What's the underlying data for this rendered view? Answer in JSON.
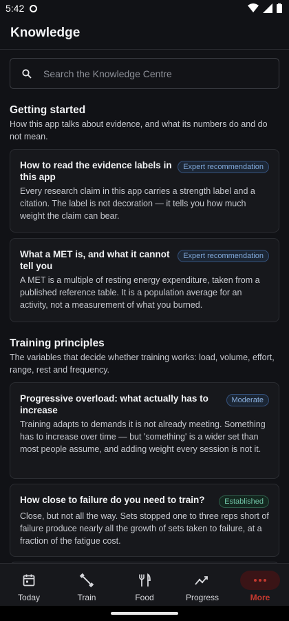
{
  "status": {
    "time": "5:42"
  },
  "app": {
    "title": "Knowledge"
  },
  "search": {
    "placeholder": "Search the Knowledge Centre"
  },
  "sections": [
    {
      "title": "Getting started",
      "description": "How this app talks about evidence, and what its numbers do and do not mean.",
      "cards": [
        {
          "title": "How to read the evidence labels in this app",
          "badge": "Expert recommendation",
          "body": "Every research claim in this app carries a strength label and a citation. The label is not decoration — it tells you how much weight the claim can bear."
        },
        {
          "title": "What a MET is, and what it cannot tell you",
          "badge": "Expert recommendation",
          "body": "A MET is a multiple of resting energy expenditure, taken from a published reference table. It is a population average for an activity, not a measurement of what you burned."
        }
      ]
    },
    {
      "title": "Training principles",
      "description": "The variables that decide whether training works: load, volume, effort, range, rest and frequency.",
      "cards": [
        {
          "title": "Progressive overload: what actually has to increase",
          "badge": "Moderate",
          "body": "Training adapts to demands it is not already meeting. Something has to increase over time — but 'something' is a wider set than most people assume, and adding weight every session is not it."
        },
        {
          "title": "How close to failure do you need to train?",
          "badge": "Established",
          "body": "Close, but not all the way. Sets stopped one to three reps short of failure produce nearly all the growth of sets taken to failure, at a fraction of the fatigue cost."
        }
      ]
    }
  ],
  "nav": {
    "items": [
      {
        "label": "Today",
        "icon": "calendar-icon"
      },
      {
        "label": "Train",
        "icon": "dumbbell-icon"
      },
      {
        "label": "Food",
        "icon": "fork-knife-icon"
      },
      {
        "label": "Progress",
        "icon": "trend-chart-icon"
      },
      {
        "label": "More",
        "icon": "more-dots-icon"
      }
    ],
    "active": "More"
  },
  "colors": {
    "background": "#111216",
    "card": "#17181c",
    "accent_active": "#c4392f",
    "badge_expert": "#7fa7d8",
    "badge_established": "#6fc1a4"
  }
}
